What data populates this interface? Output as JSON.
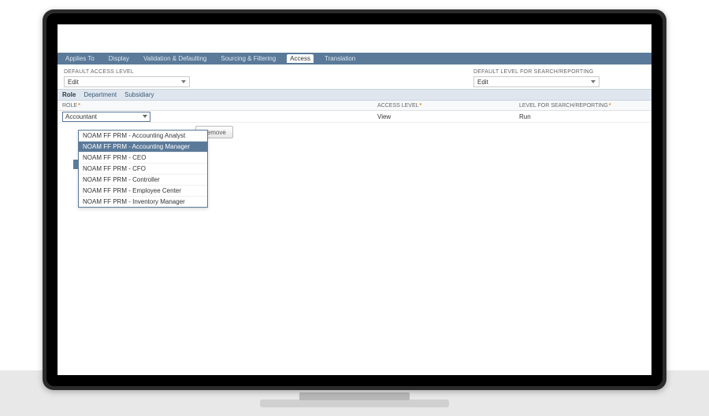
{
  "topTabs": {
    "appliesTo": "Applies To",
    "display": "Display",
    "validation": "Validation & Defaulting",
    "sourcing": "Sourcing & Filtering",
    "access": "Access",
    "translation": "Translation"
  },
  "form": {
    "defaultAccessLabel": "DEFAULT ACCESS LEVEL",
    "defaultAccessValue": "Edit",
    "defaultSearchLabel": "DEFAULT LEVEL FOR SEARCH/REPORTING",
    "defaultSearchValue": "Edit"
  },
  "subTabs": {
    "role": "Role",
    "department": "Department",
    "subsidiary": "Subsidiary"
  },
  "gridHeaders": {
    "role": "ROLE",
    "access": "ACCESS LEVEL",
    "level": "LEVEL FOR SEARCH/REPORTING"
  },
  "gridRow": {
    "roleInput": "Accountant",
    "access": "View",
    "level": "Run"
  },
  "dropdown": {
    "opt0": "NOAM FF PRM - Accounting Analyst",
    "opt1": "NOAM FF PRM - Accounting Manager",
    "opt2": "NOAM FF PRM - CEO",
    "opt3": "NOAM FF PRM - CFO",
    "opt4": "NOAM FF PRM - Controller",
    "opt5": "NOAM FF PRM - Employee Center",
    "opt6": "NOAM FF PRM - Inventory Manager"
  },
  "buttons": {
    "remove": "Remove"
  }
}
